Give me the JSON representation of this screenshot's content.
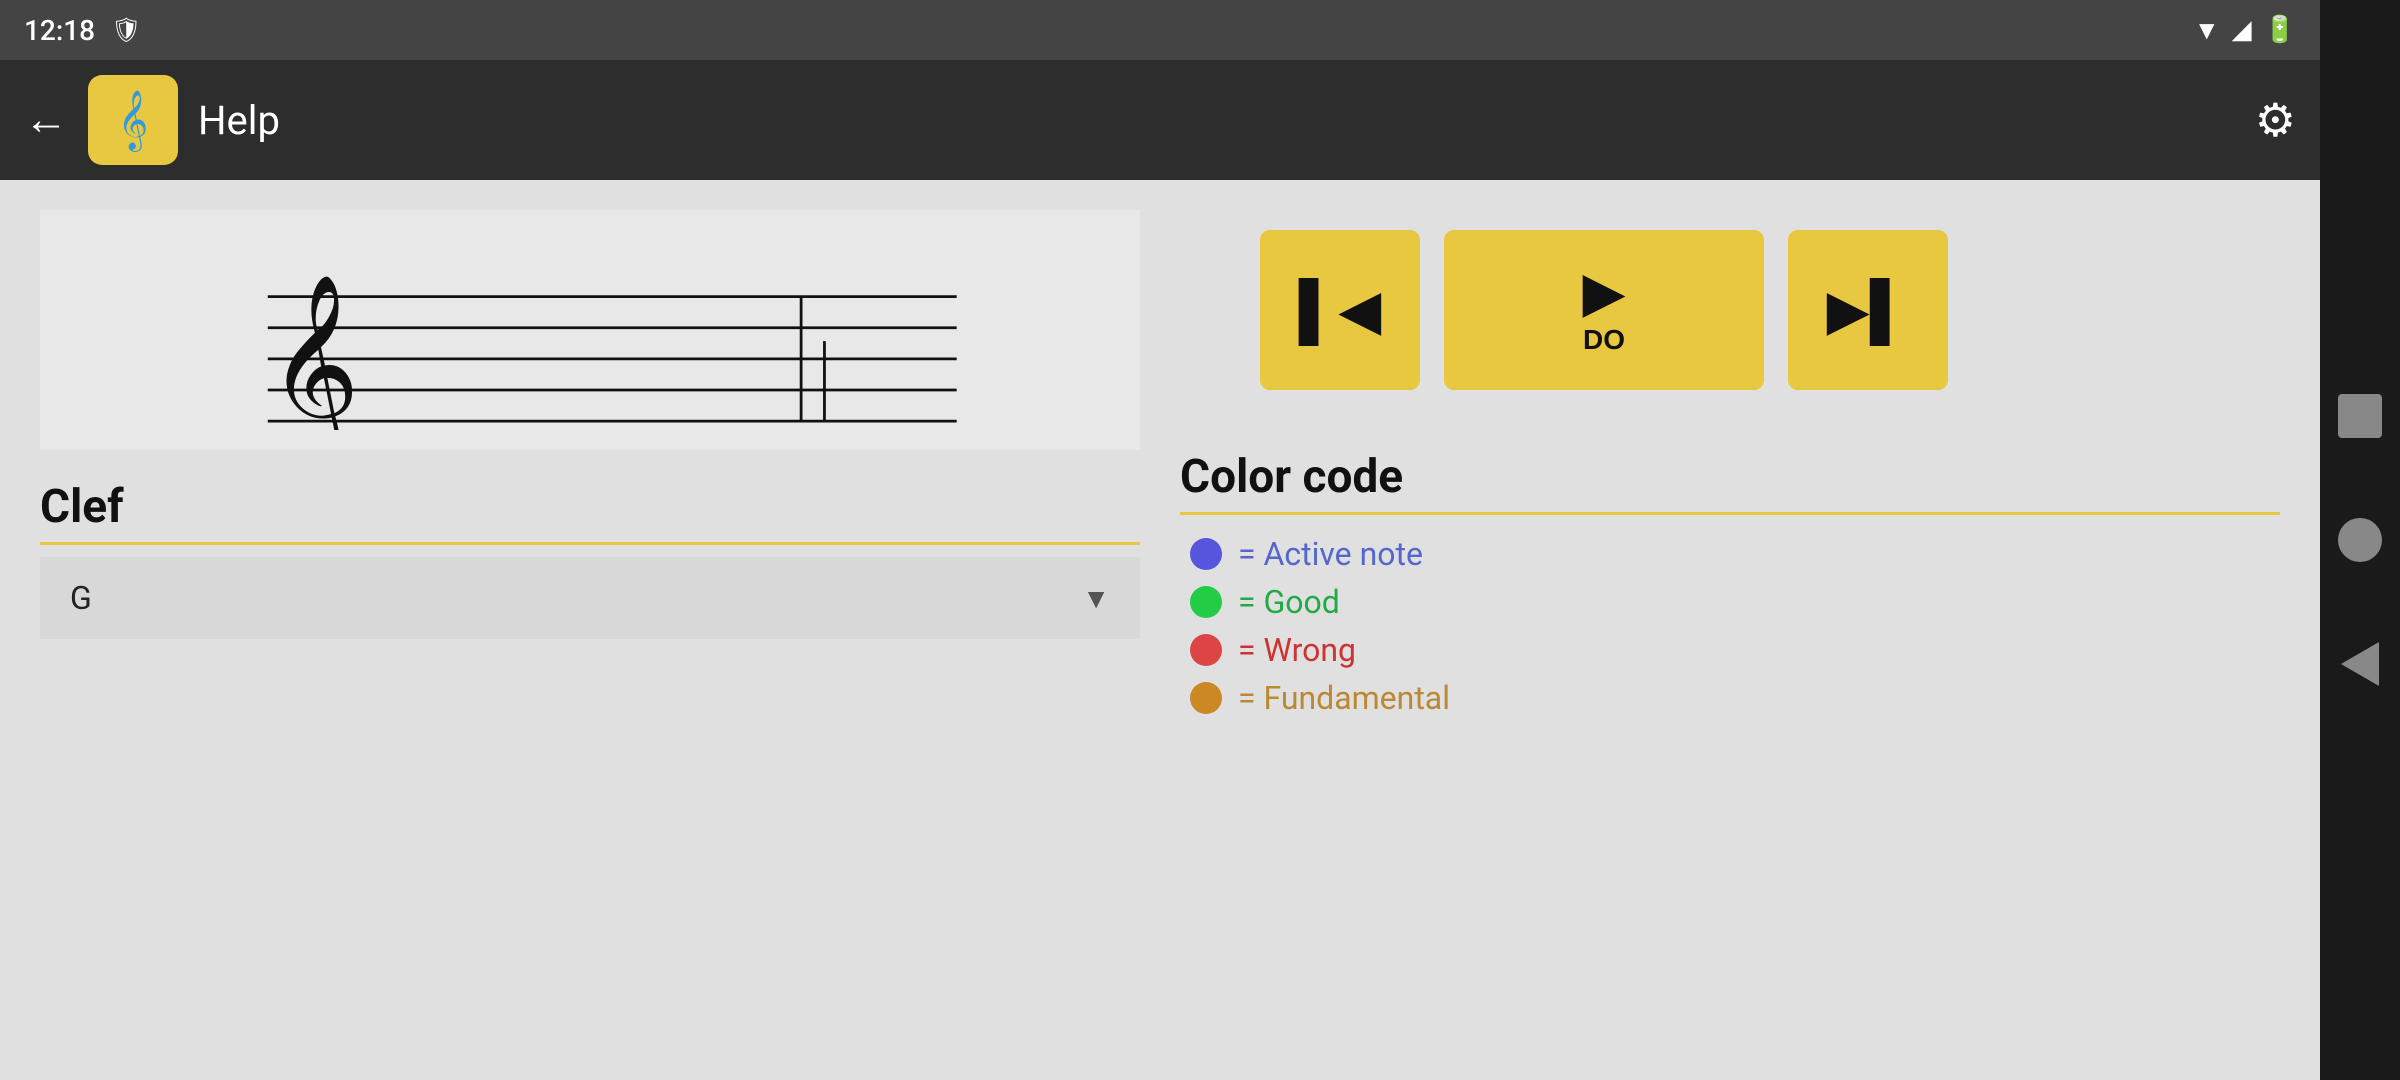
{
  "statusBar": {
    "time": "12:18",
    "icons": [
      "shield-icon",
      "wifi-icon",
      "signal-icon",
      "battery-icon"
    ]
  },
  "toolbar": {
    "backLabel": "←",
    "title": "Help",
    "settingsIcon": "⚙"
  },
  "staff": {
    "description": "Musical staff with G clef and a note"
  },
  "clef": {
    "sectionTitle": "Clef",
    "selectedValue": "G",
    "dropdownArrow": "▼"
  },
  "playback": {
    "prevIcon": "⏮",
    "playIcon": "▶",
    "playLabel": "DO",
    "nextIcon": "⏭"
  },
  "colorCode": {
    "sectionTitle": "Color code",
    "items": [
      {
        "color": "blue",
        "label": "= Active note"
      },
      {
        "color": "green",
        "label": "= Good"
      },
      {
        "color": "red",
        "label": "= Wrong"
      },
      {
        "color": "orange",
        "label": "= Fundamental"
      }
    ]
  },
  "appIcon": {
    "symbol": "𝄞"
  }
}
